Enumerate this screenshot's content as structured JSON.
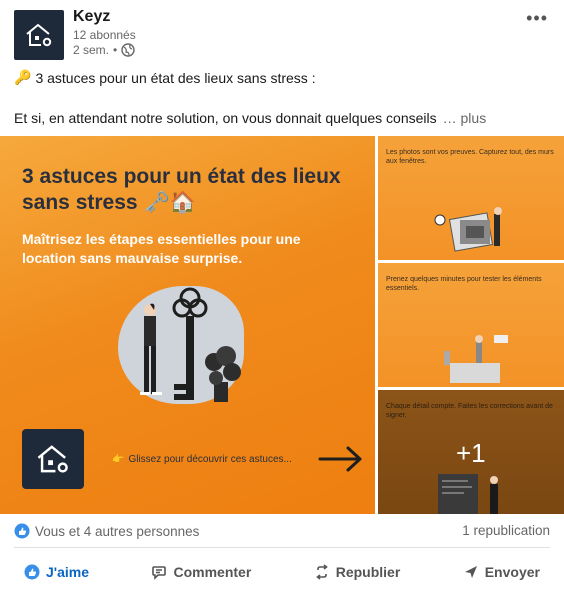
{
  "post": {
    "company_name": "Keyz",
    "followers": "12 abonnés",
    "time": "2 sem.",
    "text_line1": "3 astuces pour un état des lieux sans stress :",
    "text_line2": "Et si, en attendant notre solution, on vous donnait quelques conseils",
    "see_more": "… plus"
  },
  "media": {
    "main": {
      "title": "3 astuces pour un état des lieux sans stress",
      "subtitle": "Maîtrisez les étapes essentielles pour une location sans mauvaise surprise.",
      "swipe": "Glissez pour découvrir ces astuces..."
    },
    "slides": [
      {
        "text": "Les photos sont vos preuves. Capturez tout, des murs aux fenêtres."
      },
      {
        "text": "Prenez quelques minutes pour tester les éléments essentiels."
      },
      {
        "text": "Chaque détail compte. Faites les corrections avant de signer."
      }
    ],
    "more_count": "+1"
  },
  "stats": {
    "reactions": "Vous et 4 autres personnes",
    "reposts": "1 republication"
  },
  "actions": {
    "like": "J'aime",
    "comment": "Commenter",
    "repost": "Republier",
    "send": "Envoyer"
  },
  "colors": {
    "brand_dark": "#1e2a3a",
    "accent_orange": "#f08a1c",
    "linkedin_blue": "#0a66c2"
  }
}
